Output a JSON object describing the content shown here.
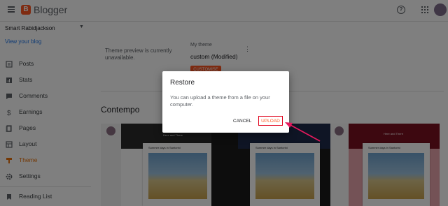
{
  "header": {
    "app_name": "Blogger"
  },
  "sidebar": {
    "blog_name": "Smart Rabidjackson",
    "view_blog": "View your blog",
    "items": [
      {
        "label": "Posts",
        "icon": "posts-icon"
      },
      {
        "label": "Stats",
        "icon": "stats-icon"
      },
      {
        "label": "Comments",
        "icon": "comments-icon"
      },
      {
        "label": "Earnings",
        "icon": "dollar-icon"
      },
      {
        "label": "Pages",
        "icon": "pages-icon"
      },
      {
        "label": "Layout",
        "icon": "layout-icon"
      },
      {
        "label": "Theme",
        "icon": "theme-icon",
        "active": true
      },
      {
        "label": "Settings",
        "icon": "gear-icon"
      },
      {
        "label": "Reading List",
        "icon": "bookmark-icon"
      }
    ]
  },
  "main": {
    "preview_message": "Theme preview is currently unavailable.",
    "my_theme_label": "My theme",
    "my_theme_value": "custom (Modified)",
    "customise_label": "CUSTOMISE",
    "section_title": "Contempo",
    "thumbnails": [
      {
        "hero_title": "Here and There",
        "card_title": "Summer days in Santorini",
        "hero_color": "#2b2b2b",
        "bg": "#ececec"
      },
      {
        "hero_title": "",
        "card_title": "Summer days in Santorini",
        "hero_color": "#1e2a4a",
        "bg": "#222222"
      },
      {
        "hero_title": "Here and There",
        "card_title": "Summer days in Santorini",
        "hero_color": "#7a1020",
        "bg": "#e9a4ad"
      }
    ]
  },
  "dialog": {
    "title": "Restore",
    "body": "You can upload a theme from a file on your computer.",
    "cancel_label": "CANCEL",
    "upload_label": "UPLOAD"
  },
  "colors": {
    "accent": "#ff5722",
    "link": "#1a73e8",
    "annotation": "#e6195d"
  }
}
